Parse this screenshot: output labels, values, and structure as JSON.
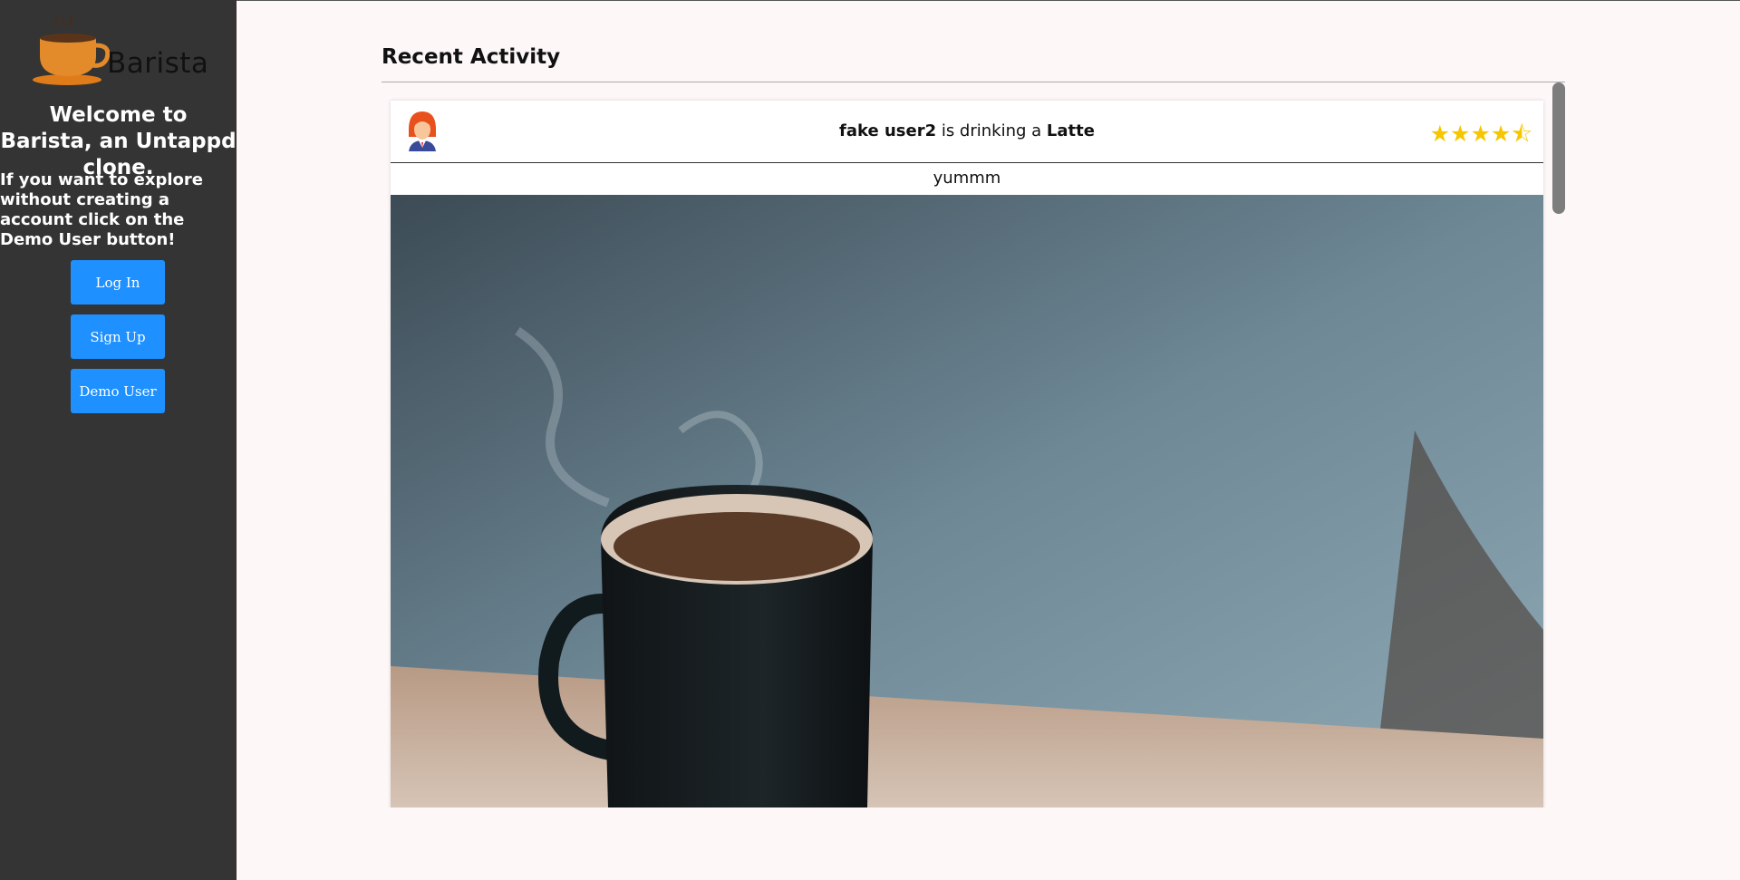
{
  "app": {
    "name": "Barista"
  },
  "sidebar": {
    "welcome": "Welcome to Barista, an Untappd clone.",
    "explore_text": "If you want to explore without creating a account click on the Demo User button!",
    "login_label": "Log In",
    "signup_label": "Sign Up",
    "demo_label": "Demo User"
  },
  "main": {
    "heading": "Recent Activity",
    "checkins": [
      {
        "user": "fake user2",
        "verb": " is drinking a ",
        "drink": "Latte",
        "rating": 4.5,
        "comment": "yummm",
        "photo_icon": "coffee-mug-photo"
      }
    ]
  },
  "colors": {
    "sidebar_bg": "#343434",
    "button_bg": "#1e90ff",
    "page_bg": "#fdf8f7",
    "star": "#f6c700"
  }
}
